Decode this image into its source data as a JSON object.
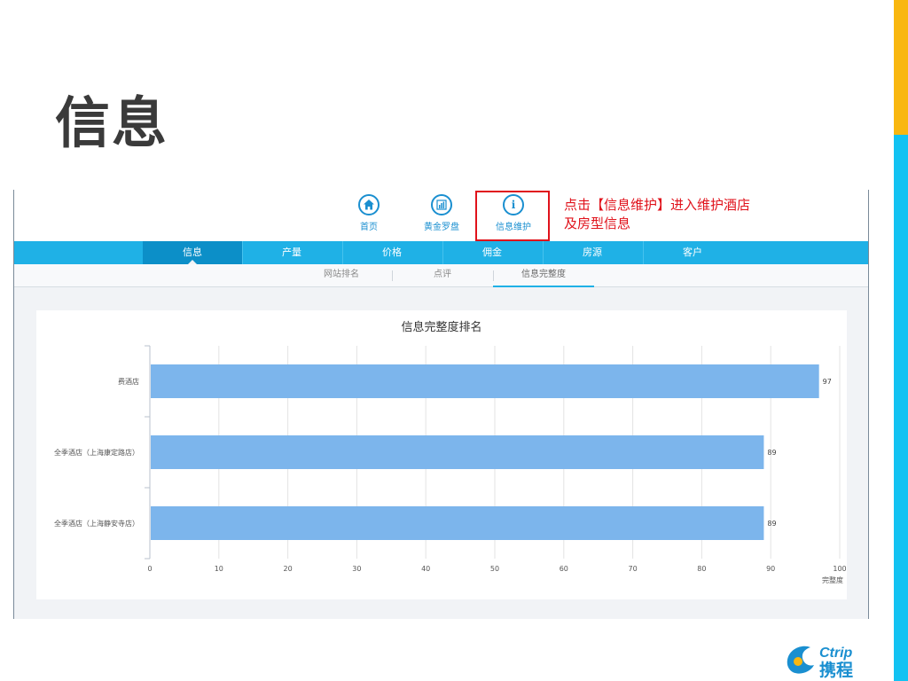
{
  "slide": {
    "title": "信息"
  },
  "brand": {
    "logo_text_top": "Ctrip",
    "logo_text_bottom": "携程",
    "colors": {
      "orange": "#f9b70f",
      "cyan": "#12c2f2",
      "annotation": "#e0121b"
    }
  },
  "topnav": [
    {
      "label": "首页",
      "icon": "home-icon"
    },
    {
      "label": "黄金罗盘",
      "icon": "bar-chart-icon"
    },
    {
      "label": "信息维护",
      "icon": "info-icon",
      "glyph": "i"
    }
  ],
  "annotation": {
    "line1": "点击【信息维护】进入维护酒店",
    "line2": "及房型信息"
  },
  "mainnav": [
    {
      "label": "信息",
      "active": true
    },
    {
      "label": "产量",
      "active": false
    },
    {
      "label": "价格",
      "active": false
    },
    {
      "label": "佣金",
      "active": false
    },
    {
      "label": "房源",
      "active": false
    },
    {
      "label": "客户",
      "active": false
    }
  ],
  "subnav": [
    {
      "label": "网站排名",
      "active": false
    },
    {
      "label": "点评",
      "active": false
    },
    {
      "label": "信息完整度",
      "active": true
    }
  ],
  "chart_data": {
    "type": "bar",
    "orientation": "horizontal",
    "title": "信息完整度排名",
    "categories": [
      "费酒店",
      "全季酒店（上海康定路店）",
      "全季酒店（上海静安寺店）"
    ],
    "values": [
      97,
      89,
      89
    ],
    "xlabel": "完整度",
    "ylabel": "",
    "xlim": [
      0,
      100
    ],
    "xticks": [
      0,
      10,
      20,
      30,
      40,
      50,
      60,
      70,
      80,
      90,
      100
    ],
    "grid": true,
    "bar_color": "#7cb5ec"
  }
}
